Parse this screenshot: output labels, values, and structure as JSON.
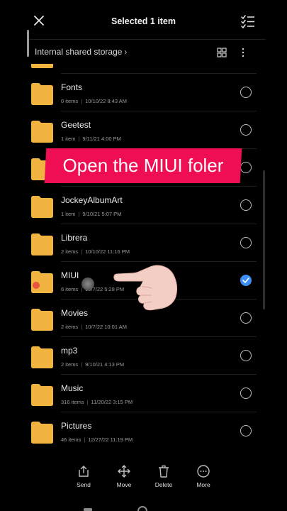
{
  "header": {
    "title": "Selected 1 item",
    "close_icon": "close-icon",
    "select_all_icon": "select-all-icon"
  },
  "breadcrumb": {
    "path": "Internal shared storage",
    "chevron": "›"
  },
  "overlay": {
    "banner_text": "Open the MIUI foler",
    "banner_color": "#ef0d53"
  },
  "files": [
    {
      "name": "Fonts",
      "items": "0 items",
      "date": "10/10/22 8:43 AM",
      "selected": false
    },
    {
      "name": "Geetest",
      "items": "1 item",
      "date": "9/11/21 4:00 PM",
      "selected": false
    },
    {
      "name": "",
      "items": "",
      "date": "",
      "selected": false
    },
    {
      "name": "JockeyAlbumArt",
      "items": "1 item",
      "date": "9/10/21 5:07 PM",
      "selected": false
    },
    {
      "name": "Librera",
      "items": "2 items",
      "date": "10/10/22 11:16 PM",
      "selected": false
    },
    {
      "name": "MIUI",
      "items": "6 items",
      "date": "10/7/22 5:29 PM",
      "selected": true
    },
    {
      "name": "Movies",
      "items": "2 items",
      "date": "10/7/22 10:01 AM",
      "selected": false
    },
    {
      "name": "mp3",
      "items": "2 items",
      "date": "9/10/21 4:13 PM",
      "selected": false
    },
    {
      "name": "Music",
      "items": "316 items",
      "date": "11/20/22 3:15 PM",
      "selected": false
    },
    {
      "name": "Pictures",
      "items": "46 items",
      "date": "12/27/22 11:19 PM",
      "selected": false
    }
  ],
  "actions": [
    {
      "label": "Send",
      "icon": "send-icon"
    },
    {
      "label": "Move",
      "icon": "move-icon"
    },
    {
      "label": "Delete",
      "icon": "delete-icon"
    },
    {
      "label": "More",
      "icon": "more-icon"
    }
  ],
  "colors": {
    "folder": "#f2b441",
    "accent": "#3d8ff5",
    "background": "#000000"
  }
}
